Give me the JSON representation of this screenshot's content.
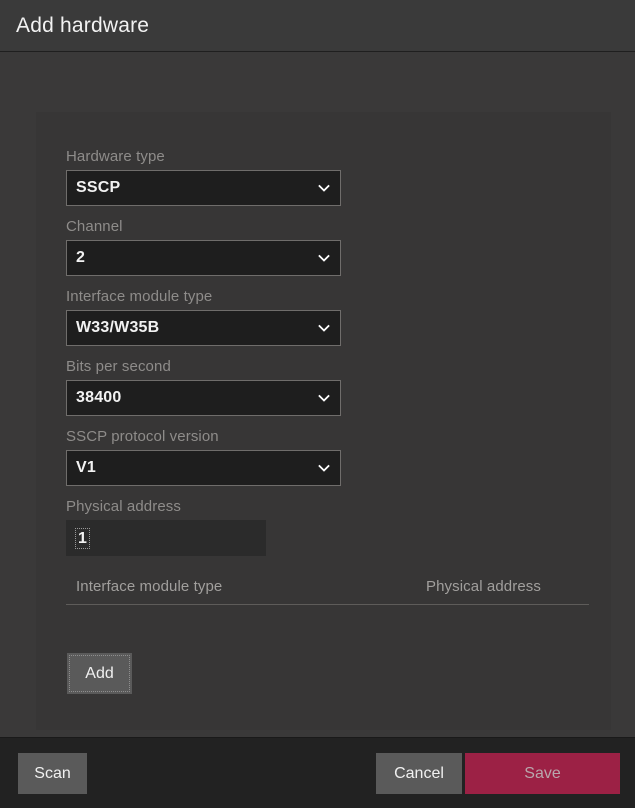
{
  "window": {
    "title": "Add hardware"
  },
  "form": {
    "fields": [
      {
        "label": "Hardware type",
        "value": "SSCP",
        "control": "select",
        "icon": "chevron-down-icon",
        "name": "hardware-type"
      },
      {
        "label": "Channel",
        "value": "2",
        "control": "select",
        "icon": "chevron-down-icon",
        "name": "channel"
      },
      {
        "label": "Interface module type",
        "value": "W33/W35B",
        "control": "select",
        "icon": "chevron-down-icon",
        "name": "interface-module-type"
      },
      {
        "label": "Bits per second",
        "value": "38400",
        "control": "select",
        "icon": "chevron-down-icon",
        "name": "bits-per-second"
      },
      {
        "label": "SSCP protocol version",
        "value": "V1",
        "control": "select",
        "icon": "chevron-down-icon",
        "name": "sscp-protocol-version"
      },
      {
        "label": "Physical address",
        "value": "1",
        "control": "text",
        "name": "physical-address"
      }
    ]
  },
  "table": {
    "columns": [
      "Interface module type",
      "Physical address"
    ],
    "rows": []
  },
  "buttons": {
    "add": "Add",
    "scan": "Scan",
    "cancel": "Cancel",
    "save": "Save"
  },
  "colors": {
    "titlebar_bg": "#3a3a3a",
    "panel_bg": "#3a3939",
    "card_bg": "#373636",
    "input_bg": "#1e1e1e",
    "input_border": "#6f6d6b",
    "text_input_bg": "#2b2b2b",
    "label_text": "#8e8c8a",
    "value_text": "#f2f2f2",
    "button_bg": "#5a5a5a",
    "save_bg": "#9c2145",
    "save_text": "#b9a6ac",
    "footer_bg": "#222222",
    "table_rule": "#5e5c5a"
  }
}
